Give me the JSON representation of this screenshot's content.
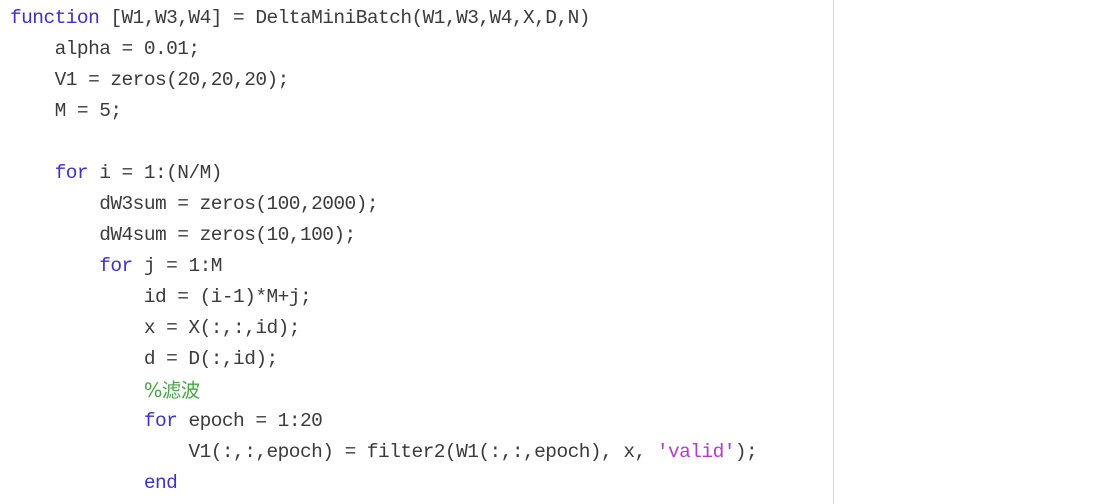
{
  "editor": {
    "language": "MATLAB",
    "background_color": "#ffffff",
    "default_text_color": "#3b3b3b",
    "keyword_color": "#3c32c8",
    "comment_color": "#4aa24a",
    "string_color": "#b03cc8",
    "margin_guide_color": "#dcdcdc",
    "indent_unit_spaces": 4
  },
  "code": {
    "lines": [
      {
        "index": 1,
        "indent": 0,
        "text": "function [W1, W3, W4] = DeltaMiniBatch(W1, W3, W4, X, D, N)",
        "tokens": [
          {
            "t": "function",
            "k": "kw"
          },
          {
            "t": " [W1,W3,W4] = DeltaMiniBatch(W1,W3,W4,X,D,N)",
            "k": "plain"
          }
        ]
      },
      {
        "index": 2,
        "indent": 4,
        "text": "alpha = 0.01;",
        "tokens": [
          {
            "t": "alpha = 0.01;",
            "k": "plain"
          }
        ]
      },
      {
        "index": 3,
        "indent": 4,
        "text": "V1 = zeros(20, 20, 20);",
        "tokens": [
          {
            "t": "V1 = zeros(20,20,20);",
            "k": "plain"
          }
        ]
      },
      {
        "index": 4,
        "indent": 4,
        "text": "M = 5;",
        "tokens": [
          {
            "t": "M = 5;",
            "k": "plain"
          }
        ]
      },
      {
        "index": 5,
        "indent": 0,
        "text": "",
        "tokens": []
      },
      {
        "index": 6,
        "indent": 4,
        "text": "for i = 1:(N/M)",
        "tokens": [
          {
            "t": "for",
            "k": "kw"
          },
          {
            "t": " i = 1:(N/M)",
            "k": "plain"
          }
        ]
      },
      {
        "index": 7,
        "indent": 8,
        "text": "dW3sum = zeros(100, 2000);",
        "tokens": [
          {
            "t": "dW3sum = zeros(100,2000);",
            "k": "plain"
          }
        ]
      },
      {
        "index": 8,
        "indent": 8,
        "text": "dW4sum = zeros(10, 100);",
        "tokens": [
          {
            "t": "dW4sum = zeros(10,100);",
            "k": "plain"
          }
        ]
      },
      {
        "index": 9,
        "indent": 8,
        "text": "for j = 1:M",
        "tokens": [
          {
            "t": "for",
            "k": "kw"
          },
          {
            "t": " j = 1:M",
            "k": "plain"
          }
        ]
      },
      {
        "index": 10,
        "indent": 12,
        "text": "id = (i-1)*M+j;",
        "tokens": [
          {
            "t": "id = (i-1)*M+j;",
            "k": "plain"
          }
        ]
      },
      {
        "index": 11,
        "indent": 12,
        "text": "x = X(:, :, id);",
        "tokens": [
          {
            "t": "x = X(:,:,id);",
            "k": "plain"
          }
        ]
      },
      {
        "index": 12,
        "indent": 12,
        "text": "d = D(:, id);",
        "tokens": [
          {
            "t": "d = D(:,id);",
            "k": "plain"
          }
        ]
      },
      {
        "index": 13,
        "indent": 12,
        "text": "%滤波",
        "tokens": [
          {
            "t": "%滤波",
            "k": "comment"
          }
        ]
      },
      {
        "index": 14,
        "indent": 12,
        "text": "for epoch = 1:20",
        "tokens": [
          {
            "t": "for",
            "k": "kw"
          },
          {
            "t": " epoch = 1:20",
            "k": "plain"
          }
        ]
      },
      {
        "index": 15,
        "indent": 16,
        "text": "V1(:, :, epoch) = filter2(W1(:, :, epoch), x, 'valid');",
        "tokens": [
          {
            "t": "V1(:,:,epoch) = filter2(W1(:,:,epoch), x, ",
            "k": "plain"
          },
          {
            "t": "'valid'",
            "k": "string"
          },
          {
            "t": ");",
            "k": "plain"
          }
        ]
      },
      {
        "index": 16,
        "indent": 12,
        "text": "end",
        "tokens": [
          {
            "t": "end",
            "k": "kw"
          }
        ]
      }
    ]
  }
}
